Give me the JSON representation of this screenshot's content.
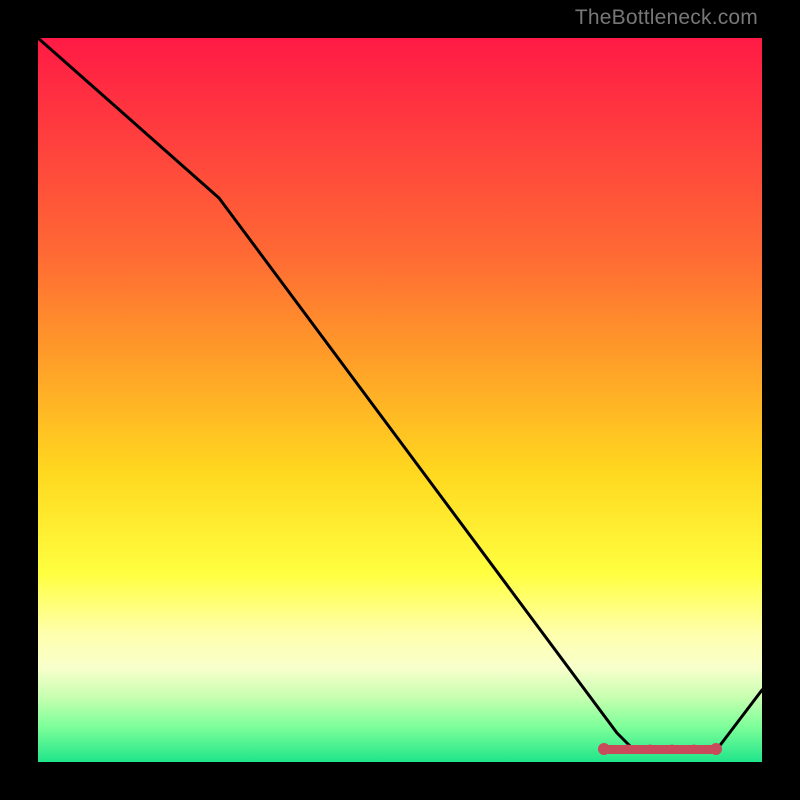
{
  "watermark": "TheBottleneck.com",
  "chart_data": {
    "type": "line",
    "title": "",
    "xlabel": "",
    "ylabel": "",
    "xlim": [
      0,
      100
    ],
    "ylim": [
      0,
      100
    ],
    "grid": false,
    "series": [
      {
        "name": "curve",
        "color": "#000000",
        "x": [
          0,
          25,
          80,
          82,
          94,
          100
        ],
        "values": [
          100,
          78,
          4,
          2,
          2,
          10
        ]
      }
    ],
    "markers": {
      "name": "flat-segment",
      "color": "#cc4455",
      "x": [
        80,
        82,
        84,
        86,
        88,
        90,
        92,
        94
      ],
      "values": [
        3,
        2,
        2.0,
        1.8,
        1.7,
        1.7,
        1.8,
        2
      ]
    },
    "background_gradient": {
      "stops": [
        {
          "pos": 0.0,
          "color": "#ff1a45"
        },
        {
          "pos": 0.3,
          "color": "#ff6a34"
        },
        {
          "pos": 0.6,
          "color": "#ffd81f"
        },
        {
          "pos": 0.82,
          "color": "#ffffaa"
        },
        {
          "pos": 0.95,
          "color": "#7fff9a"
        },
        {
          "pos": 1.0,
          "color": "#20e58a"
        }
      ]
    }
  }
}
